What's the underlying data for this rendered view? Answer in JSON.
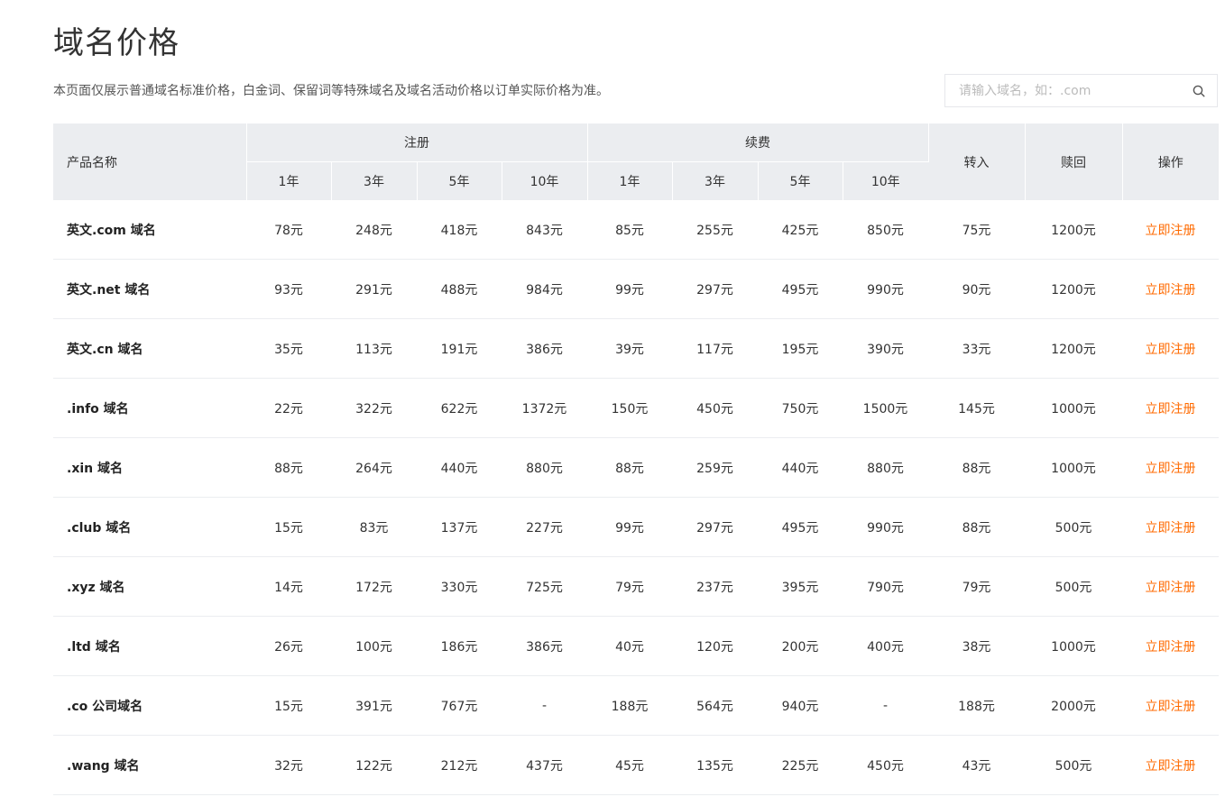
{
  "page": {
    "title": "域名价格",
    "description": "本页面仅展示普通域名标准价格，白金词、保留词等特殊域名及域名活动价格以订单实际价格为准。"
  },
  "search": {
    "placeholder": "请输入域名，如：.com",
    "icon": "search-icon"
  },
  "colors": {
    "header_bg": "#ebedf0",
    "action_link": "#ff6a00"
  },
  "table": {
    "headers": {
      "product": "产品名称",
      "register": "注册",
      "renew": "续费",
      "transfer": "转入",
      "redeem": "赎回",
      "action": "操作",
      "periods": [
        "1年",
        "3年",
        "5年",
        "10年"
      ]
    },
    "rows": [
      {
        "name": "英文.com 域名",
        "register": [
          "78元",
          "248元",
          "418元",
          "843元"
        ],
        "renew": [
          "85元",
          "255元",
          "425元",
          "850元"
        ],
        "transfer": "75元",
        "redeem": "1200元",
        "action": "立即注册"
      },
      {
        "name": "英文.net 域名",
        "register": [
          "93元",
          "291元",
          "488元",
          "984元"
        ],
        "renew": [
          "99元",
          "297元",
          "495元",
          "990元"
        ],
        "transfer": "90元",
        "redeem": "1200元",
        "action": "立即注册"
      },
      {
        "name": "英文.cn 域名",
        "register": [
          "35元",
          "113元",
          "191元",
          "386元"
        ],
        "renew": [
          "39元",
          "117元",
          "195元",
          "390元"
        ],
        "transfer": "33元",
        "redeem": "1200元",
        "action": "立即注册"
      },
      {
        "name": ".info 域名",
        "register": [
          "22元",
          "322元",
          "622元",
          "1372元"
        ],
        "renew": [
          "150元",
          "450元",
          "750元",
          "1500元"
        ],
        "transfer": "145元",
        "redeem": "1000元",
        "action": "立即注册"
      },
      {
        "name": ".xin 域名",
        "register": [
          "88元",
          "264元",
          "440元",
          "880元"
        ],
        "renew": [
          "88元",
          "259元",
          "440元",
          "880元"
        ],
        "transfer": "88元",
        "redeem": "1000元",
        "action": "立即注册"
      },
      {
        "name": ".club 域名",
        "register": [
          "15元",
          "83元",
          "137元",
          "227元"
        ],
        "renew": [
          "99元",
          "297元",
          "495元",
          "990元"
        ],
        "transfer": "88元",
        "redeem": "500元",
        "action": "立即注册"
      },
      {
        "name": ".xyz 域名",
        "register": [
          "14元",
          "172元",
          "330元",
          "725元"
        ],
        "renew": [
          "79元",
          "237元",
          "395元",
          "790元"
        ],
        "transfer": "79元",
        "redeem": "500元",
        "action": "立即注册"
      },
      {
        "name": ".ltd 域名",
        "register": [
          "26元",
          "100元",
          "186元",
          "386元"
        ],
        "renew": [
          "40元",
          "120元",
          "200元",
          "400元"
        ],
        "transfer": "38元",
        "redeem": "1000元",
        "action": "立即注册"
      },
      {
        "name": ".co 公司域名",
        "register": [
          "15元",
          "391元",
          "767元",
          "-"
        ],
        "renew": [
          "188元",
          "564元",
          "940元",
          "-"
        ],
        "transfer": "188元",
        "redeem": "2000元",
        "action": "立即注册"
      },
      {
        "name": ".wang 域名",
        "register": [
          "32元",
          "122元",
          "212元",
          "437元"
        ],
        "renew": [
          "45元",
          "135元",
          "225元",
          "450元"
        ],
        "transfer": "43元",
        "redeem": "500元",
        "action": "立即注册"
      }
    ]
  }
}
